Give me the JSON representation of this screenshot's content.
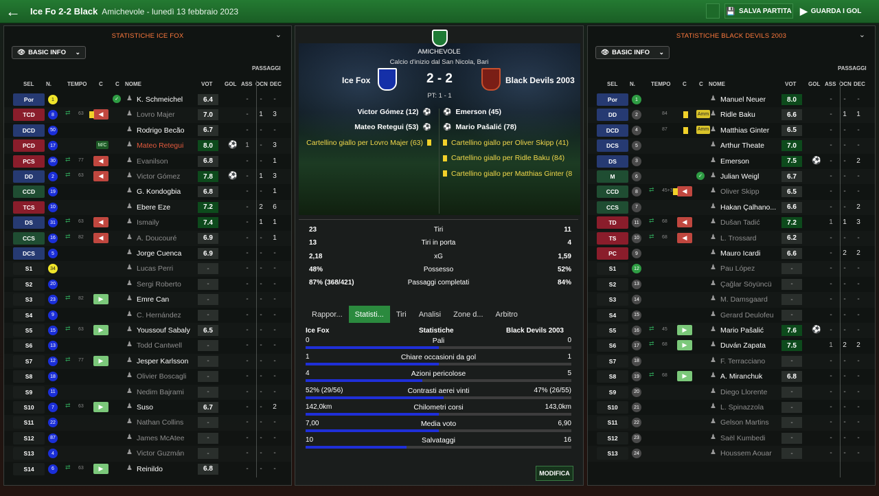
{
  "header": {
    "title": "Ice Fo 2-2 Black",
    "subtitle": "Amichevole - lunedì 13 febbraio 2023",
    "save_label": "SALVA PARTITA",
    "watch_label": "GUARDA I GOL"
  },
  "home_panel": {
    "title": "STATISTICHE ICE FOX",
    "dropdown": "BASIC INFO"
  },
  "away_panel": {
    "title": "STATISTICHE BLACK DEVILS 2003",
    "dropdown": "BASIC INFO"
  },
  "columns": {
    "sel": "SEL",
    "num": "N.",
    "tempo": "TEMPO",
    "c1": "C",
    "c2": "C",
    "name": "NOME",
    "vot": "VOT",
    "gol": "GOL",
    "ass": "ASS",
    "passaggi": "PASSAGGI",
    "ocn": "OCN",
    "dec": "DEC"
  },
  "home_players": [
    {
      "pos": "Por",
      "posc": "#263a72",
      "num": "1",
      "numc": "#f0e52a",
      "name": "K. Schmeichel",
      "st": "n",
      "vot": "6.4",
      "gk": true,
      "ass": "-",
      "ocn": "-",
      "dec": "-"
    },
    {
      "pos": "TCD",
      "posc": "#8a1d2b",
      "num": "8",
      "numc": "#1a2ed8",
      "name": "Lovro Majer",
      "st": "s",
      "t": "63",
      "tin": "⇄",
      "sub": "out",
      "vot": "7.0",
      "card": "y",
      "ass": "-",
      "ocn": "1",
      "dec": "3"
    },
    {
      "pos": "DCD",
      "posc": "#263a72",
      "num": "50",
      "numc": "#1a2ed8",
      "name": "Rodrigo Becão",
      "st": "n",
      "vot": "6.7",
      "ass": "-",
      "ocn": "-",
      "dec": "-"
    },
    {
      "pos": "PCD",
      "posc": "#8a1d2b",
      "num": "17",
      "numc": "#1a2ed8",
      "name": "Mateo Retegui",
      "st": "r",
      "vot": "8.0",
      "hi": true,
      "cap": "M/C",
      "ball": true,
      "ass": "1",
      "ocn": "-",
      "dec": "3",
      "red": true
    },
    {
      "pos": "PCS",
      "posc": "#8a1d2b",
      "num": "30",
      "numc": "#1a2ed8",
      "name": "Evanilson",
      "st": "s",
      "t": "77",
      "tin": "⇄",
      "sub": "out",
      "vot": "6.8",
      "ass": "-",
      "ocn": "-",
      "dec": "1"
    },
    {
      "pos": "DD",
      "posc": "#263a72",
      "num": "2",
      "numc": "#1a2ed8",
      "name": "Victor Gómez",
      "st": "s",
      "t": "63",
      "tin": "⇄",
      "sub": "out",
      "vot": "7.8",
      "hi": true,
      "ball": true,
      "ass": "-",
      "ocn": "1",
      "dec": "3"
    },
    {
      "pos": "CCD",
      "posc": "#1f4d32",
      "num": "19",
      "numc": "#1a2ed8",
      "name": "G. Kondogbia",
      "st": "n",
      "vot": "6.8",
      "ass": "-",
      "ocn": "-",
      "dec": "1"
    },
    {
      "pos": "TCS",
      "posc": "#8a1d2b",
      "num": "10",
      "numc": "#1a2ed8",
      "name": "Ebere Eze",
      "st": "n",
      "vot": "7.2",
      "hi": true,
      "ass": "-",
      "ocn": "2",
      "dec": "6"
    },
    {
      "pos": "DS",
      "posc": "#263a72",
      "num": "31",
      "numc": "#1a2ed8",
      "name": "Ismaily",
      "st": "s",
      "t": "63",
      "tin": "⇄",
      "sub": "out",
      "vot": "7.4",
      "hi": true,
      "ass": "-",
      "ocn": "1",
      "dec": "1"
    },
    {
      "pos": "CCS",
      "posc": "#1f4d32",
      "num": "16",
      "numc": "#1a2ed8",
      "name": "A. Doucouré",
      "st": "s",
      "t": "82",
      "tin": "⇄",
      "sub": "out",
      "vot": "6.9",
      "ass": "-",
      "ocn": "-",
      "dec": "1"
    },
    {
      "pos": "DCS",
      "posc": "#263a72",
      "num": "5",
      "numc": "#1a2ed8",
      "name": "Jorge Cuenca",
      "st": "n",
      "vot": "6.9",
      "ass": "-",
      "ocn": "-",
      "dec": "-"
    },
    {
      "pos": "S1",
      "posc": "#1a1e1c",
      "num": "34",
      "numc": "#f0e52a",
      "name": "Lucas Perri",
      "st": "b",
      "vot": "-",
      "ass": "-",
      "ocn": "-",
      "dec": "-"
    },
    {
      "pos": "S2",
      "posc": "#1a1e1c",
      "num": "20",
      "numc": "#1a2ed8",
      "name": "Sergi Roberto",
      "st": "b",
      "vot": "-",
      "ass": "-",
      "ocn": "-",
      "dec": "-"
    },
    {
      "pos": "S3",
      "posc": "#1a1e1c",
      "num": "23",
      "numc": "#1a2ed8",
      "name": "Emre Can",
      "st": "n",
      "t": "82",
      "tin": "⇄",
      "sub": "in",
      "vot": "-",
      "ass": "-",
      "ocn": "-",
      "dec": "-"
    },
    {
      "pos": "S4",
      "posc": "#1a1e1c",
      "num": "9",
      "numc": "#1a2ed8",
      "name": "C. Hernández",
      "st": "b",
      "vot": "-",
      "ass": "-",
      "ocn": "-",
      "dec": "-"
    },
    {
      "pos": "S5",
      "posc": "#1a1e1c",
      "num": "15",
      "numc": "#1a2ed8",
      "name": "Youssouf Sabaly",
      "st": "n",
      "t": "63",
      "tin": "⇄",
      "sub": "in",
      "vot": "6.5",
      "ass": "-",
      "ocn": "-",
      "dec": "-"
    },
    {
      "pos": "S6",
      "posc": "#1a1e1c",
      "num": "13",
      "numc": "#1a2ed8",
      "name": "Todd Cantwell",
      "st": "b",
      "vot": "-",
      "ass": "-",
      "ocn": "-",
      "dec": "-"
    },
    {
      "pos": "S7",
      "posc": "#1a1e1c",
      "num": "12",
      "numc": "#1a2ed8",
      "name": "Jesper Karlsson",
      "st": "n",
      "t": "77",
      "tin": "⇄",
      "sub": "in",
      "vot": "-",
      "ass": "-",
      "ocn": "-",
      "dec": "-"
    },
    {
      "pos": "S8",
      "posc": "#1a1e1c",
      "num": "18",
      "numc": "#1a2ed8",
      "name": "Olivier Boscagli",
      "st": "b",
      "vot": "-",
      "ass": "-",
      "ocn": "-",
      "dec": "-"
    },
    {
      "pos": "S9",
      "posc": "#1a1e1c",
      "num": "11",
      "numc": "#1a2ed8",
      "name": "Nedim Bajrami",
      "st": "b",
      "vot": "-",
      "ass": "-",
      "ocn": "-",
      "dec": "-"
    },
    {
      "pos": "S10",
      "posc": "#1a1e1c",
      "num": "7",
      "numc": "#1a2ed8",
      "name": "Suso",
      "st": "n",
      "t": "63",
      "tin": "⇄",
      "sub": "in",
      "vot": "6.7",
      "ass": "-",
      "ocn": "-",
      "dec": "2"
    },
    {
      "pos": "S11",
      "posc": "#1a1e1c",
      "num": "22",
      "numc": "#1a2ed8",
      "name": "Nathan Collins",
      "st": "b",
      "vot": "-",
      "ass": "-",
      "ocn": "-",
      "dec": "-"
    },
    {
      "pos": "S12",
      "posc": "#1a1e1c",
      "num": "87",
      "numc": "#1a2ed8",
      "name": "James McAtee",
      "st": "b",
      "vot": "-",
      "ass": "-",
      "ocn": "-",
      "dec": "-"
    },
    {
      "pos": "S13",
      "posc": "#1a1e1c",
      "num": "4",
      "numc": "#1a2ed8",
      "name": "Victor Guzmán",
      "st": "b",
      "vot": "-",
      "ass": "-",
      "ocn": "-",
      "dec": "-"
    },
    {
      "pos": "S14",
      "posc": "#1a1e1c",
      "num": "6",
      "numc": "#1a2ed8",
      "name": "Reinildo",
      "st": "n",
      "t": "63",
      "tin": "⇄",
      "sub": "in",
      "vot": "6.8",
      "ass": "-",
      "ocn": "-",
      "dec": "-"
    }
  ],
  "away_players": [
    {
      "pos": "Por",
      "posc": "#263a72",
      "num": "1",
      "numc": "#2e9c43",
      "name": "Manuel Neuer",
      "st": "n",
      "vot": "8.0",
      "hi": true,
      "ass": "-",
      "ocn": "-",
      "dec": "-"
    },
    {
      "pos": "DD",
      "posc": "#263a72",
      "num": "2",
      "numc": "#4a4a4a",
      "name": "Ridle Baku",
      "st": "n",
      "t": "84",
      "card": "y",
      "amm": "Amm",
      "vot": "6.6",
      "ass": "-",
      "ocn": "1",
      "dec": "1"
    },
    {
      "pos": "DCD",
      "posc": "#263a72",
      "num": "4",
      "numc": "#4a4a4a",
      "name": "Matthias Ginter",
      "st": "n",
      "t": "87",
      "card": "y",
      "amm": "Amm",
      "vot": "6.5",
      "ass": "-",
      "ocn": "-",
      "dec": "-"
    },
    {
      "pos": "DCS",
      "posc": "#263a72",
      "num": "5",
      "numc": "#4a4a4a",
      "name": "Arthur Theate",
      "st": "n",
      "vot": "7.0",
      "hi": true,
      "ass": "-",
      "ocn": "-",
      "dec": "-"
    },
    {
      "pos": "DS",
      "posc": "#263a72",
      "num": "3",
      "numc": "#4a4a4a",
      "name": "Emerson",
      "st": "n",
      "vot": "7.5",
      "hi": true,
      "ball": true,
      "ass": "-",
      "ocn": "-",
      "dec": "2"
    },
    {
      "pos": "M",
      "posc": "#1f4d32",
      "num": "6",
      "numc": "#4a4a4a",
      "name": "Julian Weigl",
      "st": "n",
      "gk": true,
      "vot": "6.7",
      "ass": "-",
      "ocn": "-",
      "dec": "-"
    },
    {
      "pos": "CCD",
      "posc": "#1f4d32",
      "num": "8",
      "numc": "#4a4a4a",
      "name": "Oliver Skipp",
      "st": "s",
      "t": "45+3",
      "tin": "⇄",
      "sub": "out",
      "card": "y",
      "vot": "6.5",
      "ass": "-",
      "ocn": "-",
      "dec": "-"
    },
    {
      "pos": "CCS",
      "posc": "#1f4d32",
      "num": "7",
      "numc": "#4a4a4a",
      "name": "Hakan Çalhano...",
      "st": "n",
      "vot": "6.6",
      "ass": "-",
      "ocn": "-",
      "dec": "2"
    },
    {
      "pos": "TD",
      "posc": "#8a1d2b",
      "num": "11",
      "numc": "#4a4a4a",
      "name": "Dušan Tadić",
      "st": "s",
      "t": "68",
      "tin": "⇄",
      "sub": "out",
      "vot": "7.2",
      "hi": true,
      "ass": "1",
      "ocn": "1",
      "dec": "3"
    },
    {
      "pos": "TS",
      "posc": "#8a1d2b",
      "num": "10",
      "numc": "#4a4a4a",
      "name": "L. Trossard",
      "st": "s",
      "t": "68",
      "tin": "⇄",
      "sub": "out",
      "vot": "6.2",
      "ass": "-",
      "ocn": "-",
      "dec": "-"
    },
    {
      "pos": "PC",
      "posc": "#8a1d2b",
      "num": "9",
      "numc": "#4a4a4a",
      "name": "Mauro Icardi",
      "st": "n",
      "vot": "6.6",
      "ass": "-",
      "ocn": "2",
      "dec": "2"
    },
    {
      "pos": "S1",
      "posc": "#1a1e1c",
      "num": "12",
      "numc": "#2e9c43",
      "name": "Pau López",
      "st": "b",
      "vot": "-",
      "ass": "-",
      "ocn": "-",
      "dec": "-"
    },
    {
      "pos": "S2",
      "posc": "#1a1e1c",
      "num": "13",
      "numc": "#4a4a4a",
      "name": "Çağlar Söyüncü",
      "st": "b",
      "vot": "-",
      "ass": "-",
      "ocn": "-",
      "dec": "-"
    },
    {
      "pos": "S3",
      "posc": "#1a1e1c",
      "num": "14",
      "numc": "#4a4a4a",
      "name": "M. Damsgaard",
      "st": "b",
      "vot": "-",
      "ass": "-",
      "ocn": "-",
      "dec": "-"
    },
    {
      "pos": "S4",
      "posc": "#1a1e1c",
      "num": "15",
      "numc": "#4a4a4a",
      "name": "Gerard Deulofeu",
      "st": "b",
      "vot": "-",
      "ass": "-",
      "ocn": "-",
      "dec": "-"
    },
    {
      "pos": "S5",
      "posc": "#1a1e1c",
      "num": "16",
      "numc": "#4a4a4a",
      "name": "Mario Pašalić",
      "st": "n",
      "t": "45",
      "tin": "⇄",
      "sub": "in",
      "vot": "7.6",
      "hi": true,
      "ball": true,
      "ass": "-",
      "ocn": "-",
      "dec": "-"
    },
    {
      "pos": "S6",
      "posc": "#1a1e1c",
      "num": "17",
      "numc": "#4a4a4a",
      "name": "Duván Zapata",
      "st": "n",
      "t": "68",
      "tin": "⇄",
      "sub": "in",
      "vot": "7.5",
      "hi": true,
      "ass": "1",
      "ocn": "2",
      "dec": "2"
    },
    {
      "pos": "S7",
      "posc": "#1a1e1c",
      "num": "18",
      "numc": "#4a4a4a",
      "name": "F. Terracciano",
      "st": "b",
      "vot": "-",
      "ass": "-",
      "ocn": "-",
      "dec": "-"
    },
    {
      "pos": "S8",
      "posc": "#1a1e1c",
      "num": "19",
      "numc": "#4a4a4a",
      "name": "A. Miranchuk",
      "st": "n",
      "t": "68",
      "tin": "⇄",
      "sub": "in",
      "vot": "6.8",
      "ass": "-",
      "ocn": "-",
      "dec": "-"
    },
    {
      "pos": "S9",
      "posc": "#1a1e1c",
      "num": "20",
      "numc": "#4a4a4a",
      "name": "Diego Llorente",
      "st": "b",
      "vot": "-",
      "ass": "-",
      "ocn": "-",
      "dec": "-"
    },
    {
      "pos": "S10",
      "posc": "#1a1e1c",
      "num": "21",
      "numc": "#4a4a4a",
      "name": "L. Spinazzola",
      "st": "b",
      "vot": "-",
      "ass": "-",
      "ocn": "-",
      "dec": "-"
    },
    {
      "pos": "S11",
      "posc": "#1a1e1c",
      "num": "22",
      "numc": "#4a4a4a",
      "name": "Gelson Martins",
      "st": "b",
      "vot": "-",
      "ass": "-",
      "ocn": "-",
      "dec": "-"
    },
    {
      "pos": "S12",
      "posc": "#1a1e1c",
      "num": "23",
      "numc": "#4a4a4a",
      "name": "Saël Kumbedi",
      "st": "b",
      "vot": "-",
      "ass": "-",
      "ocn": "-",
      "dec": "-"
    },
    {
      "pos": "S13",
      "posc": "#1a1e1c",
      "num": "24",
      "numc": "#4a4a4a",
      "name": "Houssem Aouar",
      "st": "b",
      "vot": "-",
      "ass": "-",
      "ocn": "-",
      "dec": "-"
    }
  ],
  "match": {
    "competition": "AMICHEVOLE",
    "venue": "Calcio d'inizio dal San Nicola, Bari",
    "home": "Ice Fox",
    "away": "Black Devils 2003",
    "score": "2 - 2",
    "pt": "PT: 1 - 1"
  },
  "events_home": [
    {
      "text": "Victor Gómez (12)",
      "type": "goal"
    },
    {
      "text": "Mateo Retegui (53)",
      "type": "goal"
    },
    {
      "text": "Cartellino giallo per Lovro Majer (63)",
      "type": "yellow"
    }
  ],
  "events_away": [
    {
      "text": "Emerson (45)",
      "type": "goal"
    },
    {
      "text": "Mario Pašalić (78)",
      "type": "goal"
    },
    {
      "text": "Cartellino giallo per Oliver Skipp (41)",
      "type": "yellow"
    },
    {
      "text": "Cartellino giallo per Ridle Baku (84)",
      "type": "yellow"
    },
    {
      "text": "Cartellino giallo per Matthias Ginter (8",
      "type": "yellow"
    }
  ],
  "summary": [
    {
      "l": "23",
      "m": "Tiri",
      "r": "11"
    },
    {
      "l": "13",
      "m": "Tiri in porta",
      "r": "4"
    },
    {
      "l": "2,18",
      "m": "xG",
      "r": "1,59"
    },
    {
      "l": "48%",
      "m": "Possesso",
      "r": "52%"
    },
    {
      "l": "87% (368/421)",
      "m": "Passaggi completati",
      "r": "84%"
    }
  ],
  "tabs": [
    "Rappor...",
    "Statisti...",
    "Tiri",
    "Analisi",
    "Zone d...",
    "Arbitro"
  ],
  "stats_header": {
    "home": "Ice Fox",
    "mid": "Statistiche",
    "away": "Black Devils 2003"
  },
  "stats": [
    {
      "l": "0",
      "m": "Pali",
      "r": "0",
      "p": 0.5
    },
    {
      "l": "1",
      "m": "Chiare occasioni da gol",
      "r": "1",
      "p": 0.5
    },
    {
      "l": "4",
      "m": "Azioni pericolose",
      "r": "5",
      "p": 0.44
    },
    {
      "l": "52% (29/56)",
      "m": "Contrasti aerei vinti",
      "r": "47% (26/55)",
      "p": 0.52
    },
    {
      "l": "142,0km",
      "m": "Chilometri corsi",
      "r": "143,0km",
      "p": 0.5
    },
    {
      "l": "7,00",
      "m": "Media voto",
      "r": "6,90",
      "p": 0.5
    },
    {
      "l": "10",
      "m": "Salvataggi",
      "r": "16",
      "p": 0.38
    }
  ],
  "modifica": "MODIFICA"
}
